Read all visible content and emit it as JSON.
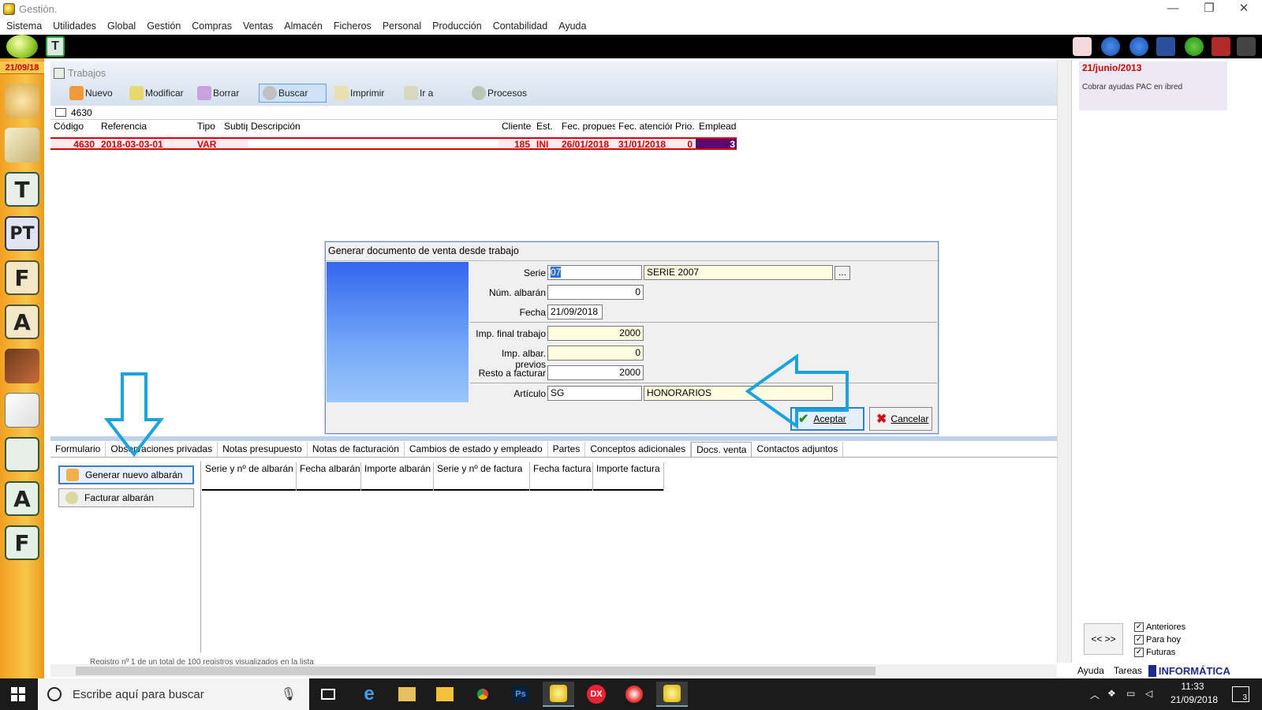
{
  "window": {
    "title": "Gestión.",
    "minimize": "—",
    "restore": "❐",
    "close": "✕"
  },
  "menu": [
    "Sistema",
    "Utilidades",
    "Global",
    "Gestión",
    "Compras",
    "Ventas",
    "Almacén",
    "Ficheros",
    "Personal",
    "Producción",
    "Contabilidad",
    "Ayuda"
  ],
  "sidebar": {
    "date": "21/09/18",
    "icons": [
      "people-icon",
      "cards-icon",
      "T",
      "PT",
      "F-box",
      "A-box",
      "book-icon",
      "write-icon",
      "list-icon",
      "A",
      "F"
    ]
  },
  "module": {
    "title": "Trabajos",
    "toolbar": [
      "Nuevo",
      "Modificar",
      "Borrar",
      "Buscar",
      "Imprimir",
      "Ir a",
      "Procesos"
    ],
    "record_id": "4630",
    "grid": {
      "headers": [
        "Código",
        "Referencia",
        "Tipo",
        "Subtip",
        "Descripción",
        "Cliente",
        "Est.",
        "Fec. propues.",
        "Fec. atención",
        "Prio.",
        "Empleado"
      ],
      "row": [
        "4630",
        "2018-03-03-01",
        "VAR",
        "",
        "",
        "185",
        "INI",
        "26/01/2018",
        "31/01/2018",
        "0",
        "3"
      ]
    },
    "tabs": [
      "Formulario",
      "Observaciones privadas",
      "Notas presupuesto",
      "Notas de facturación",
      "Cambios de estado y empleado",
      "Partes",
      "Conceptos adicionales",
      "Docs. venta",
      "Contactos adjuntos"
    ],
    "active_tab": "Docs. venta",
    "side_buttons": {
      "generate": "Generar nuevo albarán",
      "invoice": "Facturar albarán"
    },
    "subgrid_headers": [
      "Serie y nº de albarán",
      "Fecha albarán",
      "Importe albarán",
      "Serie y nº de factura",
      "Fecha factura",
      "Importe factura"
    ],
    "status": "Registro nº 1 de un total de 100 registros visualizados en la lista"
  },
  "dialog": {
    "title": "Generar documento de venta desde trabajo",
    "labels": {
      "serie": "Serie",
      "num_albaran": "Núm. albarán",
      "fecha": "Fecha",
      "imp_final": "Imp. final trabajo",
      "imp_previos": "Imp. albar. previos",
      "resto": "Resto a facturar",
      "articulo": "Artículo"
    },
    "values": {
      "serie_code": "07",
      "serie_name": "SERIE 2007",
      "num_albaran": "0",
      "fecha": "21/09/2018",
      "imp_final": "2000",
      "imp_previos": "0",
      "resto": "2000",
      "articulo_code": "SG",
      "articulo_name": "HONORARIOS"
    },
    "browse": "...",
    "accept": "Aceptar",
    "cancel": "Cancelar"
  },
  "right_panel": {
    "date": "21/junio/2013",
    "task": "Cobrar ayudas PAC en ibred",
    "nav": "<< >>",
    "filters": [
      "Anteriores",
      "Para hoy",
      "Futuras"
    ],
    "tabs": [
      "Ayuda",
      "Tareas"
    ],
    "brand": "INFORMÁTICA"
  },
  "taskbar": {
    "search_placeholder": "Escribe aquí para buscar",
    "time": "11:33",
    "date": "21/09/2018",
    "notifications": "3"
  },
  "colors": {
    "accent_red": "#cc0000",
    "highlight_blue": "#2d7fd3",
    "arrow_blue": "#1aa3dd",
    "sidebar_orange": "#f7c64a"
  }
}
